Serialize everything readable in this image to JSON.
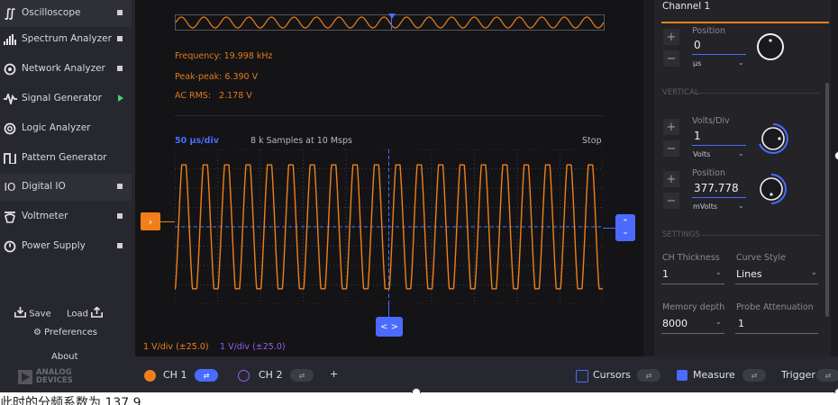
{
  "sidebar": {
    "items": [
      {
        "label": "Oscilloscope",
        "icon": "oscilloscope-icon",
        "glyph": "∬",
        "state": "stop",
        "selected": true
      },
      {
        "label": "Spectrum Analyzer",
        "icon": "spectrum-icon",
        "glyph": "▐",
        "state": "stop",
        "selected": false
      },
      {
        "label": "Network Analyzer",
        "icon": "network-icon",
        "glyph": "©",
        "state": "stop",
        "selected": false
      },
      {
        "label": "Signal Generator",
        "icon": "signal-icon",
        "glyph": "∿",
        "state": "running",
        "selected": false
      },
      {
        "label": "Logic Analyzer",
        "icon": "logic-icon",
        "glyph": "©",
        "state": "none",
        "selected": false
      },
      {
        "label": "Pattern Generator",
        "icon": "pattern-icon",
        "glyph": "∏",
        "state": "none",
        "selected": false
      },
      {
        "label": "Digital IO",
        "icon": "digital-io-icon",
        "glyph": "IO",
        "state": "stop",
        "selected": true
      },
      {
        "label": "Voltmeter",
        "icon": "voltmeter-icon",
        "glyph": "≡",
        "state": "stop",
        "selected": false
      },
      {
        "label": "Power Supply",
        "icon": "power-icon",
        "glyph": "⊕",
        "state": "stop",
        "selected": false
      }
    ],
    "save_label": "Save",
    "load_label": "Load",
    "preferences_label": "Preferences",
    "about_label": "About",
    "logo_line1": "ANALOG",
    "logo_line2": "DEVICES"
  },
  "plot": {
    "frequency": "Frequency: 19.998 kHz",
    "peak_peak": "Peak-peak: 6.390 V",
    "ac_rms_label": "AC RMS:",
    "ac_rms_value": "2.178 V",
    "time_div": "50 µs/div",
    "samples": "8 k Samples at 10 Msps",
    "status": "Stop",
    "ch1_vdiv": "1 V/div (±25.0)",
    "ch2_vdiv": "1 V/div (±25.0)",
    "trigger_btn": "›",
    "horiz_btn": "< >"
  },
  "right_panel": {
    "title": "Channel 1",
    "position_label": "Position",
    "position_value": "0",
    "position_unit": "µs",
    "vertical_section": "VERTICAL",
    "volts_div_label": "Volts/Div",
    "volts_div_value": "1",
    "volts_div_unit": "Volts",
    "v_position_label": "Position",
    "v_position_value": "377.778",
    "v_position_unit": "mVolts",
    "settings_section": "SETTINGS",
    "ch_thickness_label": "CH Thickness",
    "ch_thickness_value": "1",
    "curve_style_label": "Curve Style",
    "curve_style_value": "Lines",
    "memory_depth_label": "Memory depth",
    "memory_depth_value": "8000",
    "probe_attenuation_label": "Probe Attenuation",
    "probe_attenuation_value": "1"
  },
  "bottom_bar": {
    "ch1_label": "CH 1",
    "ch2_label": "CH 2",
    "add_label": "+",
    "cursors_label": "Cursors",
    "measure_label": "Measure",
    "trigger_label": "Trigger"
  },
  "caption": "此时的分频系数为 137.9",
  "colors": {
    "ch1": "#f07f1a",
    "ch2": "#9b5cf0",
    "accent": "#4b6bff",
    "running": "#4fd06c"
  },
  "waveform": {
    "cycles": 20,
    "high_v": 3.2,
    "low_v": -3.2,
    "offset_v": 0.378
  }
}
